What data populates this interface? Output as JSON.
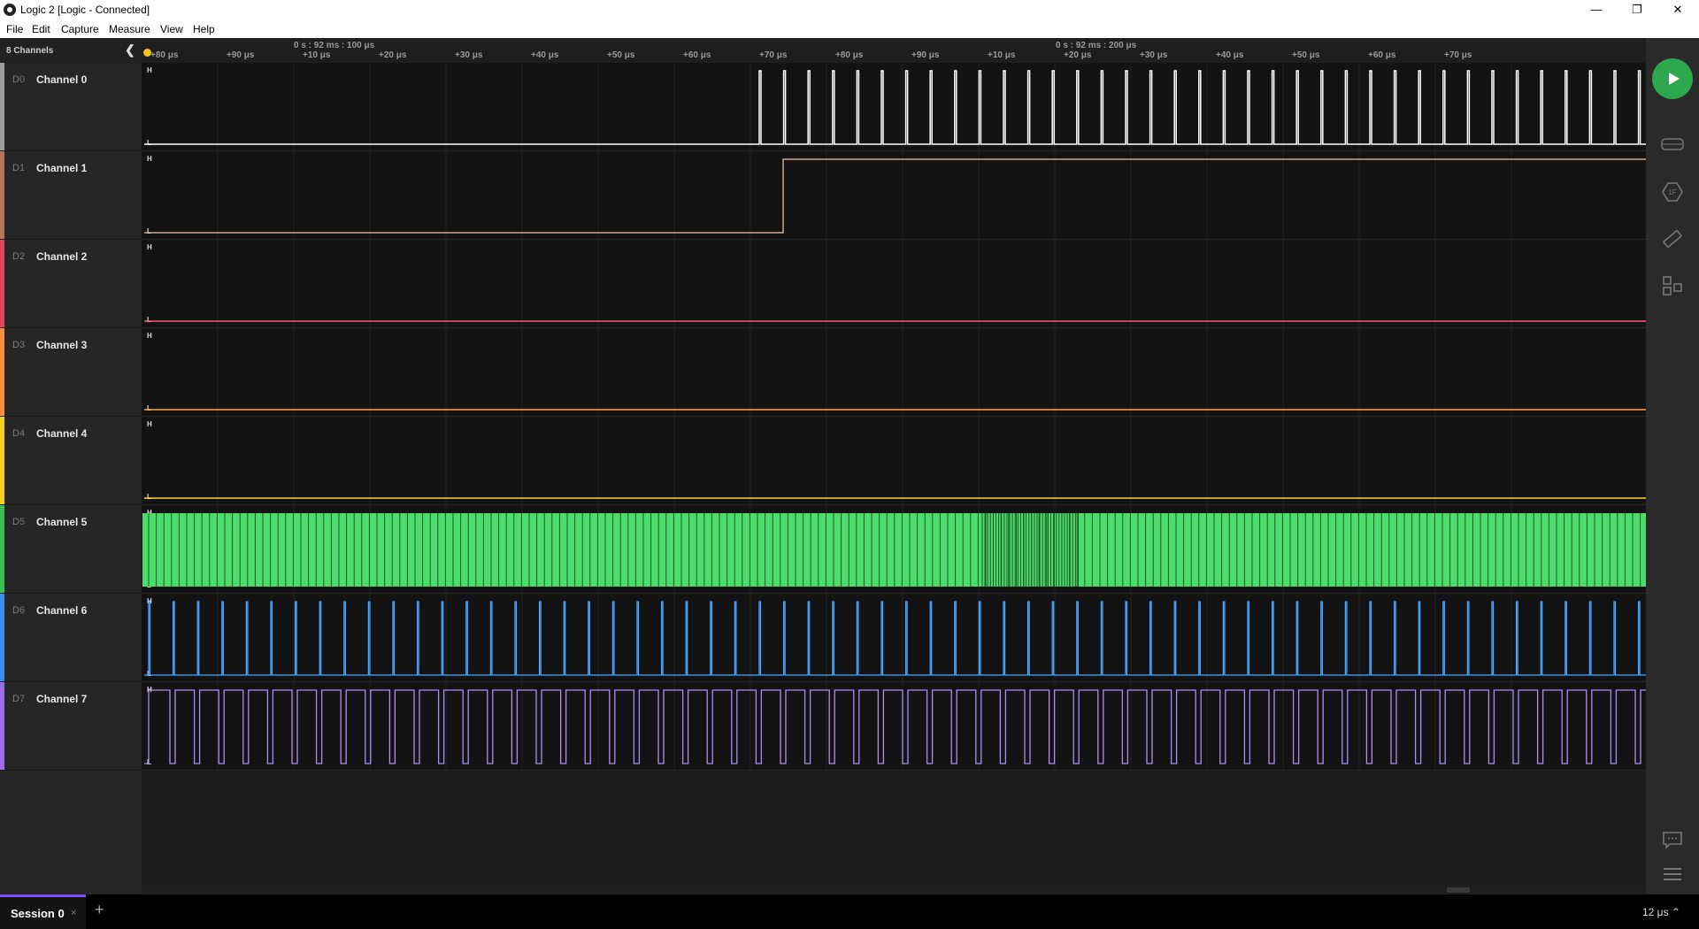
{
  "window": {
    "title": "Logic 2 [Logic - Connected]",
    "minimize": "—",
    "maximize": "❐",
    "close": "✕"
  },
  "menu": [
    "File",
    "Edit",
    "Capture",
    "Measure",
    "View",
    "Help"
  ],
  "sidebar": {
    "channel_count": "8 Channels",
    "collapse_icon": "chevron-left-icon"
  },
  "channels": [
    {
      "id": "D0",
      "name": "Channel 0",
      "color": "#9e9e9e",
      "trace": "#ffffff"
    },
    {
      "id": "D1",
      "name": "Channel 1",
      "color": "#b0775a",
      "trace": "#f2c8a8"
    },
    {
      "id": "D2",
      "name": "Channel 2",
      "color": "#e0455e",
      "trace": "#ff5a6e"
    },
    {
      "id": "D3",
      "name": "Channel 3",
      "color": "#ff8f3a",
      "trace": "#ffa64d"
    },
    {
      "id": "D4",
      "name": "Channel 4",
      "color": "#f2d21e",
      "trace": "#f5d630"
    },
    {
      "id": "D5",
      "name": "Channel 5",
      "color": "#3cbf53",
      "trace": "#4cdc6a"
    },
    {
      "id": "D6",
      "name": "Channel 6",
      "color": "#3a8ef0",
      "trace": "#4aa6ff"
    },
    {
      "id": "D7",
      "name": "Channel 7",
      "color": "#9b6ce8",
      "trace": "#b08cf5"
    }
  ],
  "ruler": {
    "ref_labels": [
      "0 s : 92 ms : 100 μs",
      "0 s : 92 ms : 200 μs"
    ],
    "tick_labels": [
      "+80 μs",
      "+90 μs",
      "+10 μs",
      "+20 μs",
      "+30 μs",
      "+40 μs",
      "+50 μs",
      "+60 μs",
      "+70 μs",
      "+80 μs",
      "+90 μs",
      "+10 μs",
      "+20 μs",
      "+30 μs",
      "+40 μs",
      "+50 μs",
      "+60 μs",
      "+70 μs"
    ]
  },
  "level_labels": {
    "high": "H",
    "low": "L"
  },
  "rail": {
    "play": "play-icon",
    "icons": [
      "device-icon",
      "analyzer-icon",
      "measure-icon",
      "extensions-icon",
      "comment-icon",
      "menu-icon"
    ]
  },
  "tabs": {
    "session": "Session 0",
    "close": "×",
    "add": "+"
  },
  "status": {
    "zoom": "12 μs ⌃"
  }
}
